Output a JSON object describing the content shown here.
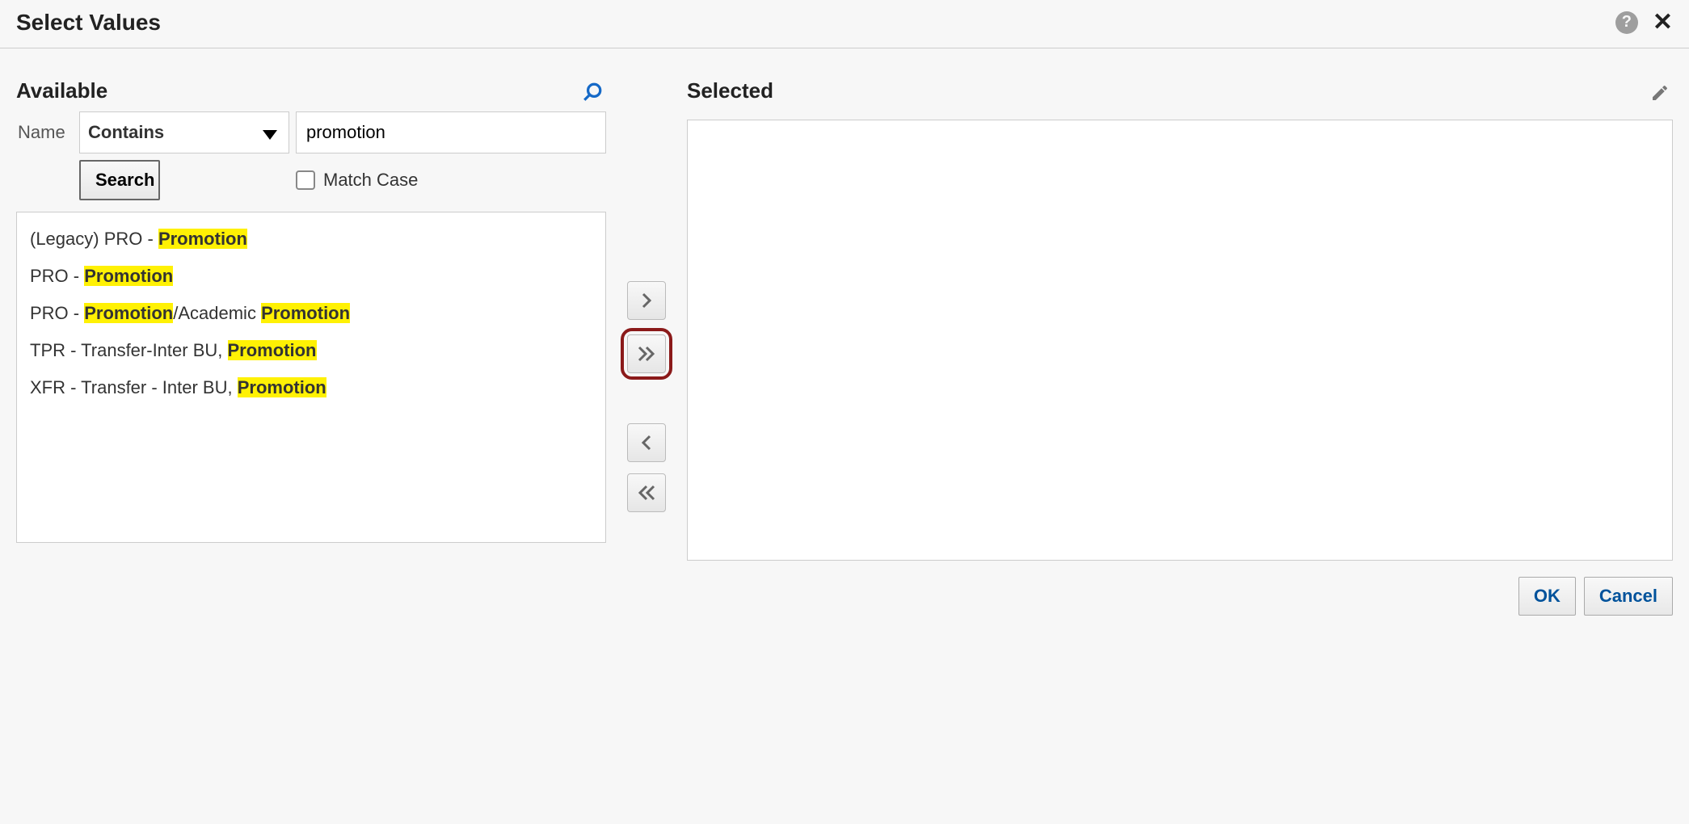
{
  "dialog": {
    "title": "Select Values"
  },
  "available": {
    "heading": "Available",
    "name_label": "Name",
    "operator_selected": "Contains",
    "search_term": "promotion",
    "search_button": "Search",
    "match_case_label": "Match Case",
    "match_case_checked": false,
    "highlight": "Promotion",
    "items": [
      "(Legacy) PRO - Promotion",
      "PRO - Promotion",
      "PRO - Promotion/Academic Promotion",
      "TPR - Transfer-Inter BU, Promotion",
      "XFR - Transfer - Inter BU, Promotion"
    ]
  },
  "shuttle": {
    "move_right": "Move",
    "move_all_right": "Move All",
    "move_left": "Remove",
    "move_all_left": "Remove All",
    "highlighted_button": "move_all_right"
  },
  "selected": {
    "heading": "Selected",
    "items": []
  },
  "footer": {
    "ok": "OK",
    "cancel": "Cancel"
  }
}
